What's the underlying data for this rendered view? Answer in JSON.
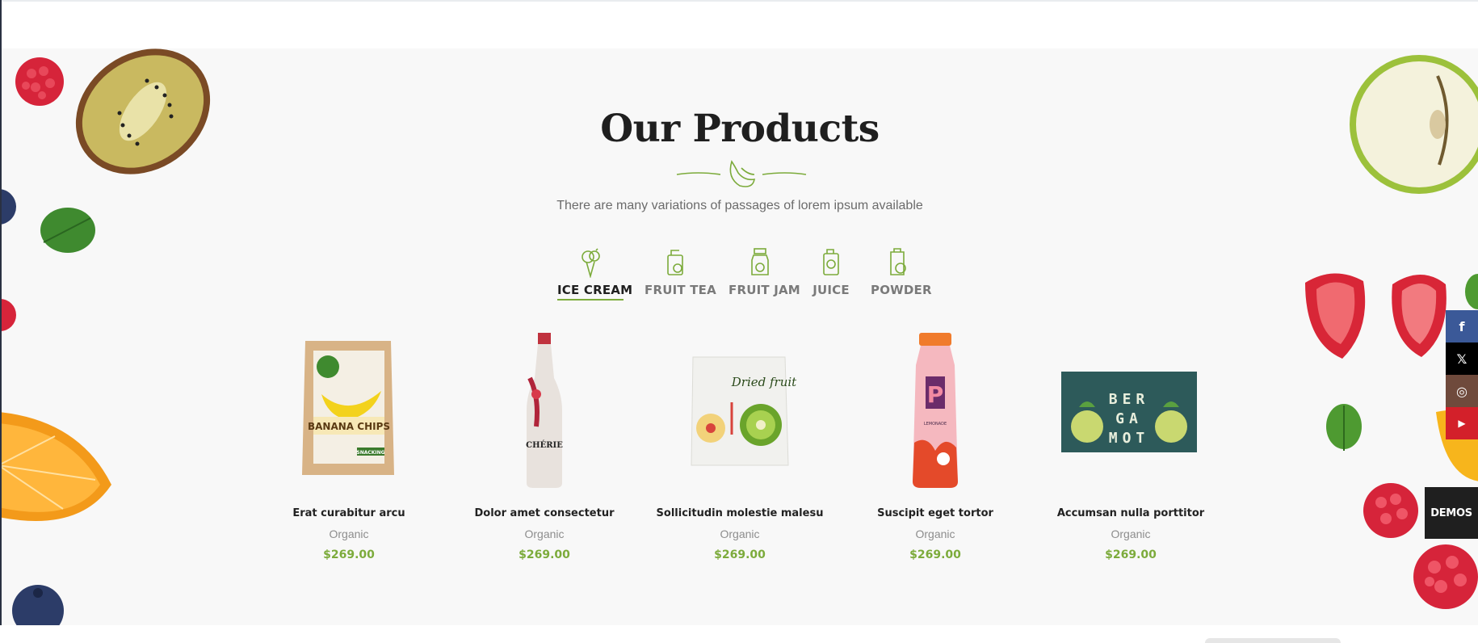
{
  "section": {
    "title": "Our Products",
    "subtitle": "There are many variations of passages of lorem ipsum available"
  },
  "tabs": [
    {
      "label": "ICE CREAM",
      "icon": "ice-cream-icon",
      "active": true
    },
    {
      "label": "FRUIT TEA",
      "icon": "fruit-tea-icon",
      "active": false
    },
    {
      "label": "FRUIT JAM",
      "icon": "fruit-jam-icon",
      "active": false
    },
    {
      "label": "JUICE",
      "icon": "juice-icon",
      "active": false
    },
    {
      "label": "POWDER",
      "icon": "powder-icon",
      "active": false
    }
  ],
  "products": [
    {
      "name": "Erat curabitur arcu",
      "category": "Organic",
      "price": "$269.00",
      "image": "banana-chips-bag",
      "package_text": "BANANA CHIPS",
      "package_subtext": "SNACKING"
    },
    {
      "name": "Dolor amet consectetur",
      "category": "Organic",
      "price": "$269.00",
      "image": "cherie-bottle",
      "package_text": "CHÉRIE"
    },
    {
      "name": "Sollicitudin molestie malesu",
      "category": "Organic",
      "price": "$269.00",
      "image": "dried-fruit-pack",
      "package_text": "Dried fruit"
    },
    {
      "name": "Suscipit eget tortor",
      "category": "Organic",
      "price": "$269.00",
      "image": "lemonade-bottle",
      "package_text": "P",
      "package_subtext": "LEMONADE"
    },
    {
      "name": "Accumsan nulla porttitor",
      "category": "Organic",
      "price": "$269.00",
      "image": "bergamot-box",
      "package_text": "BER GA MOT"
    }
  ],
  "social": [
    {
      "name": "facebook",
      "glyph": "f",
      "color": "#3b5998"
    },
    {
      "name": "x",
      "glyph": "𝕏",
      "color": "#000000"
    },
    {
      "name": "instagram",
      "glyph": "◎",
      "color": "#6f4a3c"
    },
    {
      "name": "youtube",
      "glyph": "▶",
      "color": "#d3202a"
    }
  ],
  "demos_label": "DEMOS",
  "colors": {
    "accent": "#7cab3b",
    "title": "#1f1f1f",
    "section_bg": "#f8f8f8"
  }
}
